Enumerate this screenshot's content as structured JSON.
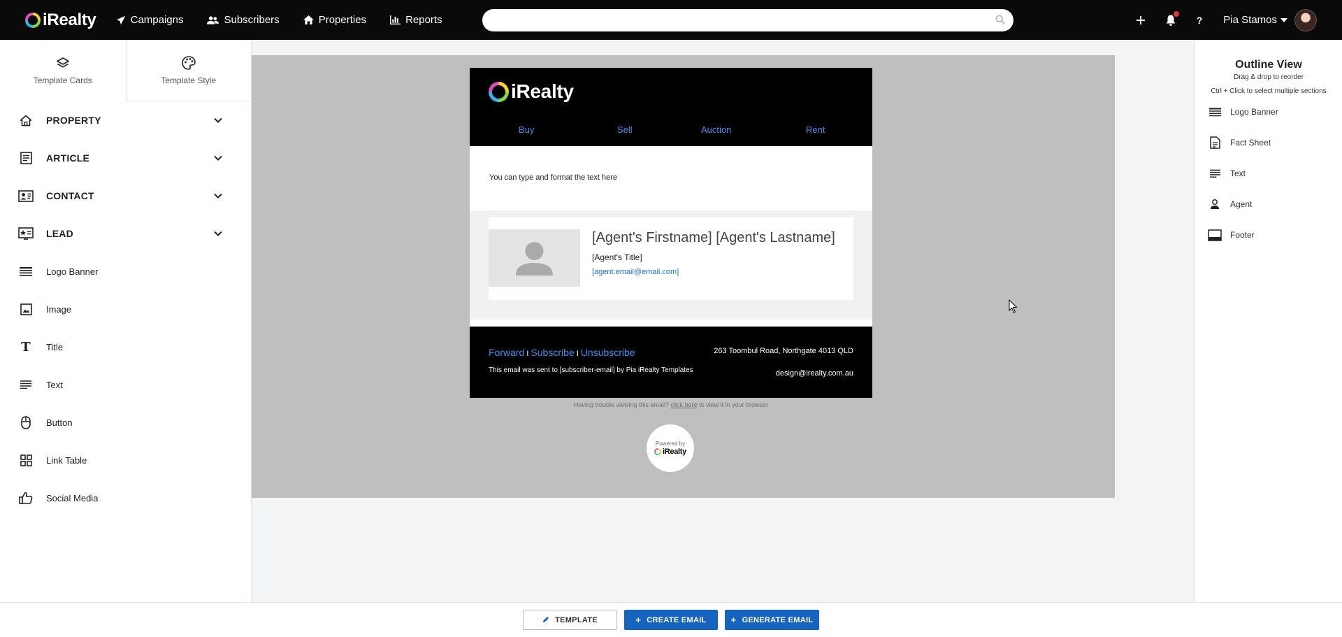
{
  "topbar": {
    "brand": "iRealty",
    "nav": [
      {
        "label": "Campaigns",
        "icon": "paper-plane-icon"
      },
      {
        "label": "Subscribers",
        "icon": "users-icon"
      },
      {
        "label": "Properties",
        "icon": "home-icon"
      },
      {
        "label": "Reports",
        "icon": "bar-chart-icon"
      }
    ],
    "search": {
      "value": "",
      "placeholder": ""
    },
    "user_name": "Pia Stamos",
    "notification_dot": true
  },
  "sidebar": {
    "tabs": [
      {
        "label": "Template Cards",
        "icon": "layers-icon"
      },
      {
        "label": "Template Style",
        "icon": "palette-icon"
      }
    ],
    "items": [
      {
        "label": "PROPERTY",
        "icon": "home-outline-icon",
        "expandable": true
      },
      {
        "label": "ARTICLE",
        "icon": "article-icon",
        "expandable": true
      },
      {
        "label": "CONTACT",
        "icon": "contact-card-icon",
        "expandable": true
      },
      {
        "label": "LEAD",
        "icon": "lead-icon",
        "expandable": true
      },
      {
        "label": "Logo Banner",
        "icon": "banner-icon"
      },
      {
        "label": "Image",
        "icon": "image-icon"
      },
      {
        "label": "Title",
        "icon": "title-icon"
      },
      {
        "label": "Text",
        "icon": "text-lines-icon"
      },
      {
        "label": "Button",
        "icon": "mouse-icon"
      },
      {
        "label": "Link Table",
        "icon": "grid-icon"
      },
      {
        "label": "Social Media",
        "icon": "thumbs-up-icon"
      }
    ]
  },
  "email": {
    "logo_text": "iRealty",
    "nav": [
      "Buy",
      "Sell",
      "Auction",
      "Rent"
    ],
    "body_text": "You can type and format the text here",
    "agent": {
      "name": "[Agent's Firstname] [Agent's Lastname]",
      "title": "[Agent's Title]",
      "email": "[agent.email@email.com]"
    },
    "footer": {
      "links": [
        "Forward",
        "Subscribe",
        "Unsubscribe"
      ],
      "separator": "I",
      "sent_text": "This email was sent to [subscriber-email] by Pia iRealty Templates",
      "address": "263 Toombul Road, Northgate 4013 QLD",
      "contact_email": "design@irealty.com.au"
    },
    "trouble_pre": "Having trouble viewing this email? ",
    "trouble_link": "click here",
    "trouble_post": " to view it in your browser",
    "powered_by": "Powered by",
    "powered_brand": "iRealty"
  },
  "outline": {
    "title": "Outline View",
    "subtitle": "Drag & drop to reorder",
    "hint": "Ctrl + Click to select multiple sections",
    "items": [
      {
        "label": "Logo Banner",
        "icon": "banner-icon"
      },
      {
        "label": "Fact Sheet",
        "icon": "document-icon"
      },
      {
        "label": "Text",
        "icon": "text-lines-icon"
      },
      {
        "label": "Agent",
        "icon": "person-icon"
      },
      {
        "label": "Footer",
        "icon": "footer-icon"
      }
    ]
  },
  "bottombar": {
    "template": "TEMPLATE",
    "create": "CREATE EMAIL",
    "generate": "GENERATE EMAIL"
  },
  "colors": {
    "topbar": "#0a0a0a",
    "accent": "#1565c0",
    "email_link": "#3f8ef3",
    "canvas": "#bfbfbf"
  }
}
